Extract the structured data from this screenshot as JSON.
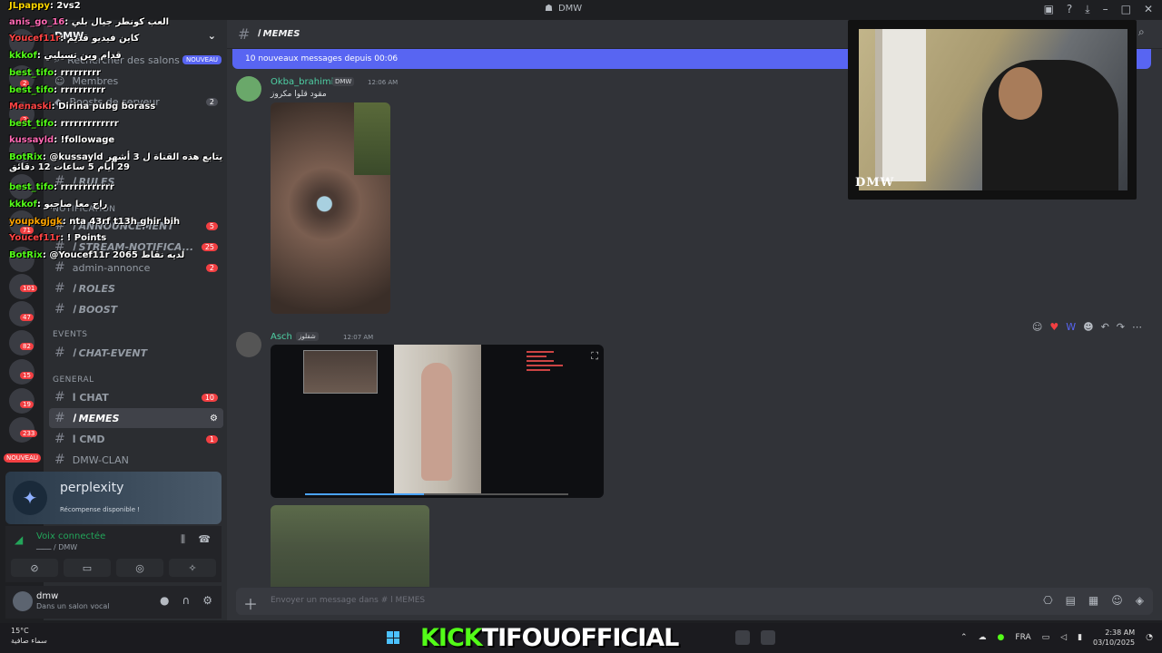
{
  "app": {
    "title": "DMW"
  },
  "channel_header": {
    "name": "ا MEMES"
  },
  "new_messages_bar": "10 nouveaux messages depuis 00:06",
  "search_placeholder": "Rechercher des salons",
  "sidebar": {
    "server_name": "DMW",
    "new_badge": "NOUVEAU",
    "items": [
      {
        "label": "Rechercher des salons"
      },
      {
        "label": "Membres"
      },
      {
        "label": "Boosts de serveur",
        "badge": "2"
      },
      {
        "label": "ا RULES"
      },
      {
        "label": "ا ANNOUNCEMENT",
        "badge": "5"
      },
      {
        "label": "ا STREAM-NOTIFICA...",
        "badge": "25"
      },
      {
        "label": "admin-annonce",
        "badge": "2"
      },
      {
        "label": "ا ROLES"
      },
      {
        "label": "ا BOOST"
      },
      {
        "label": "ا CHAT-EVENT"
      },
      {
        "label": "ا CHAT",
        "badge": "10"
      },
      {
        "label": "ا MEMES"
      },
      {
        "label": "ا CMD",
        "badge": "1"
      },
      {
        "label": "DMW-CLAN"
      }
    ],
    "categories": {
      "notification": "NOTIFICATION",
      "events": "EVENTS",
      "general": "GENERAL"
    }
  },
  "rail_badges": [
    "2",
    "2",
    "71",
    "101",
    "47",
    "82",
    "15",
    "19",
    "233"
  ],
  "chat_overlay": [
    {
      "user": "JLpappy",
      "text": ": 2vs2"
    },
    {
      "user": "anis_go_16",
      "text": ": العب كونطر جيال بلي"
    },
    {
      "user": "Youcef11r",
      "text": ": كاين فيديو قديم"
    },
    {
      "user": "kkkof",
      "text": ": قدام وين تسيلبي"
    },
    {
      "user": "best_tifo",
      "text": ": rrrrrrrrr"
    },
    {
      "user": "best_tifo",
      "text": ": rrrrrrrrrr"
    },
    {
      "user": "Menaski",
      "text": ": Dirina pubg borass"
    },
    {
      "user": "best_tifo",
      "text": ": rrrrrrrrrrrrr"
    },
    {
      "user": "kussayld",
      "text": ": !followage"
    },
    {
      "user": "BotRix",
      "text": ": @kussayld يتابع هذه القناة ل 3 أشهر 29 أيام 5 ساعات 12 دقائق"
    },
    {
      "user": "best_tifo",
      "text": ": rrrrrrrrrrrr"
    },
    {
      "user": "kkkof",
      "text": ": راح معا صاحبو"
    },
    {
      "user": "youpkgjgk",
      "text": ": nta 43rf t13h ghir bih"
    },
    {
      "user": "Youcef11r",
      "text": ": ! Points"
    },
    {
      "user": "BotRix",
      "text": ": @Youcef11r 2065 لديه نقاط"
    }
  ],
  "promo": {
    "title": "perplexity",
    "subtitle": "Récompense disponible !"
  },
  "voice": {
    "status": "Voix connectée",
    "channel": "ـــــــ / DMW"
  },
  "user": {
    "name": "dmw",
    "status": "Dans un salon vocal"
  },
  "messages": [
    {
      "author": "Okba_brahimi",
      "tag": "DMW",
      "time": "12:06 AM",
      "text": "مقود قلوا مكروز"
    },
    {
      "author": "Asch",
      "tag": "شقلوز",
      "time": "12:07 AM"
    }
  ],
  "input": {
    "placeholder": "Envoyer un message dans #  ا MEMES"
  },
  "webcam": {
    "logo": "DMW"
  },
  "taskbar": {
    "temp": "15°C",
    "weather": "سماء صافية",
    "banner_kick": "KICK",
    "banner_name": "TIFOUOFFICIAL",
    "lang": "FRA",
    "time": "2:38 AM",
    "date": "03/10/2025"
  }
}
